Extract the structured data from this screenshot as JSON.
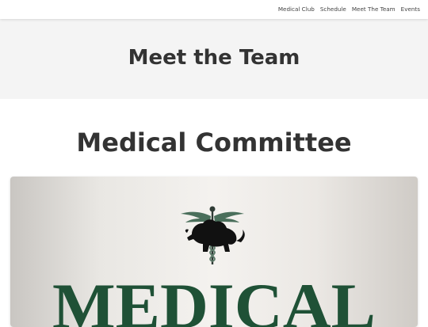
{
  "nav": {
    "items": [
      {
        "label": "Medical Club"
      },
      {
        "label": "Schedule"
      },
      {
        "label": "Meet The Team"
      },
      {
        "label": "Events"
      }
    ]
  },
  "hero": {
    "title": "Meet the Team"
  },
  "section": {
    "title": "Medical Committee"
  },
  "poster": {
    "word": "MEDICAL",
    "emblem_icon": "lion-caduceus-emblem-icon",
    "text_color": "#1f5136"
  },
  "colors": {
    "hero_bg": "#f4f4f4",
    "heading": "#333333",
    "accent_green": "#1f5136"
  }
}
